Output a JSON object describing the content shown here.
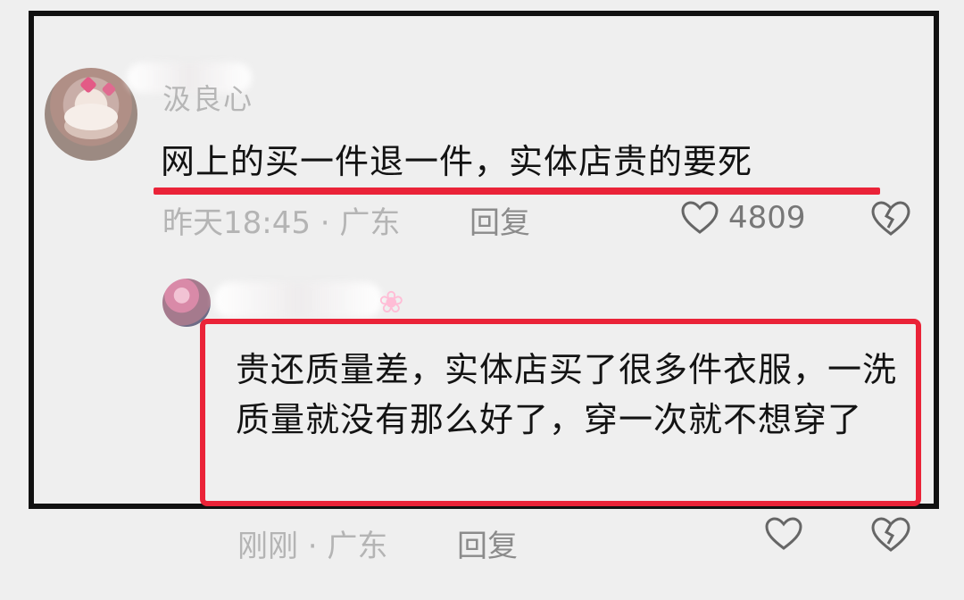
{
  "comments": {
    "first": {
      "username_blurred": "汲良心",
      "text": "网上的买一件退一件，实体店贵的要死",
      "time_location": "昨天18:45 · 广东",
      "reply_label": "回复",
      "like_count": "4809"
    },
    "second": {
      "text": "贵还质量差，实体店买了很多件衣服，一洗质量就没有那么好了，穿一次就不想穿了",
      "time_location": "刚刚 · 广东",
      "reply_label": "回复"
    }
  },
  "icons": {
    "heart": "heart-icon",
    "broken_heart": "broken-heart-icon"
  },
  "colors": {
    "highlight": "#ea2338",
    "meta_text": "#b4b4b4"
  }
}
